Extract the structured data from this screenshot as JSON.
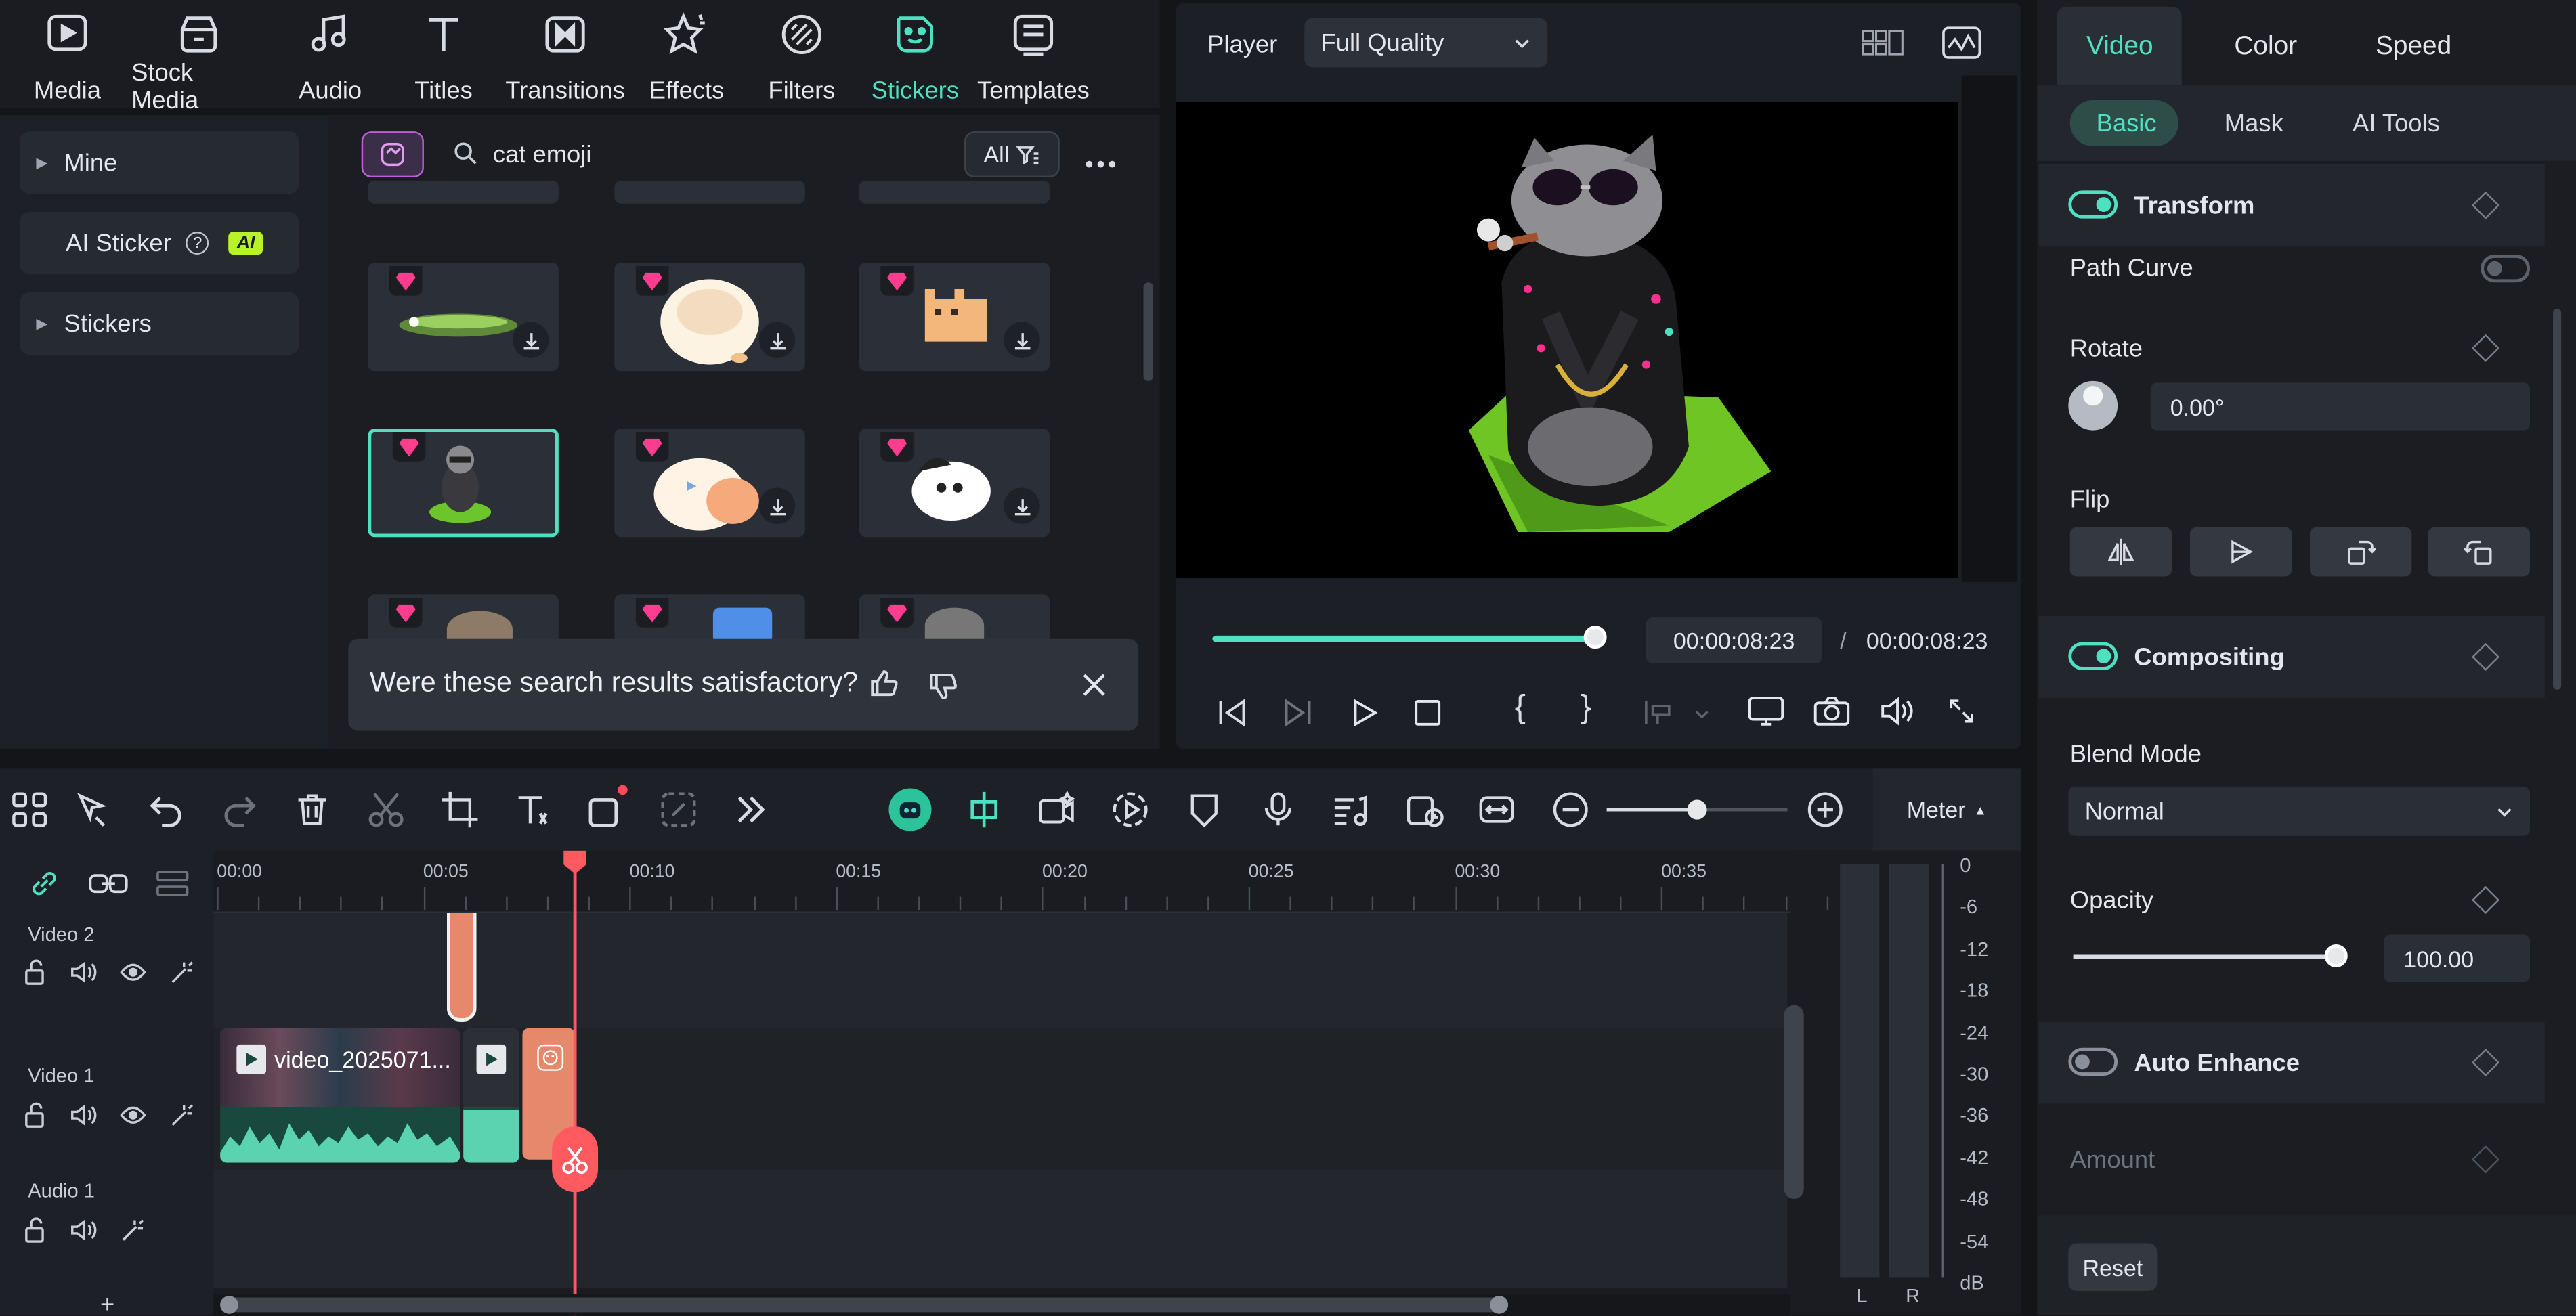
{
  "toolbar": {
    "items": [
      {
        "label": "Media",
        "icon": "media-icon"
      },
      {
        "label": "Stock Media",
        "icon": "stock-media-icon"
      },
      {
        "label": "Audio",
        "icon": "music-note-icon"
      },
      {
        "label": "Titles",
        "icon": "title-t-icon"
      },
      {
        "label": "Transitions",
        "icon": "transition-icon"
      },
      {
        "label": "Effects",
        "icon": "effects-star-icon"
      },
      {
        "label": "Filters",
        "icon": "filter-icon"
      },
      {
        "label": "Stickers",
        "icon": "sticker-icon",
        "active": true
      },
      {
        "label": "Templates",
        "icon": "template-icon"
      }
    ],
    "accent": "#4fe0c2"
  },
  "sidebar": {
    "items": [
      {
        "label": "Mine"
      },
      {
        "label": "AI Sticker",
        "badge": "AI"
      },
      {
        "label": "Stickers"
      }
    ]
  },
  "search": {
    "value": "cat emoji",
    "filter_label": "All"
  },
  "feedback": {
    "question": "Were these search results satisfactory?"
  },
  "player": {
    "label": "Player",
    "quality": "Full Quality",
    "current_time": "00:00:08:23",
    "separator": "/",
    "total_time": "00:00:08:23",
    "progress": 1.0
  },
  "timeline": {
    "meter_label": "Meter",
    "ruler": [
      "00:00",
      "00:05",
      "00:10",
      "00:15",
      "00:20",
      "00:25",
      "00:30",
      "00:35"
    ],
    "tracks": [
      {
        "label": "Video 2"
      },
      {
        "label": "Video 1"
      },
      {
        "label": "Audio 1"
      }
    ],
    "clip_name": "video_2025071...",
    "add_track": "+",
    "meter_scale": [
      "0",
      "-6",
      "-12",
      "-18",
      "-24",
      "-30",
      "-36",
      "-42",
      "-48",
      "-54",
      "dB"
    ],
    "channels": [
      "L",
      "R"
    ]
  },
  "properties": {
    "tabs": [
      "Video",
      "Color",
      "Speed"
    ],
    "active_tab": "Video",
    "subtabs": [
      "Basic",
      "Mask",
      "AI Tools"
    ],
    "active_subtab": "Basic",
    "transform": {
      "label": "Transform",
      "enabled": true
    },
    "path_curve": {
      "label": "Path Curve",
      "enabled": false
    },
    "rotate": {
      "label": "Rotate",
      "value": "0.00°"
    },
    "flip": {
      "label": "Flip"
    },
    "compositing": {
      "label": "Compositing",
      "enabled": true
    },
    "blend_mode": {
      "label": "Blend Mode",
      "value": "Normal"
    },
    "opacity": {
      "label": "Opacity",
      "value": "100.00",
      "level": 1.0
    },
    "auto_enhance": {
      "label": "Auto Enhance",
      "enabled": false
    },
    "amount": {
      "label": "Amount"
    },
    "reset_label": "Reset"
  }
}
